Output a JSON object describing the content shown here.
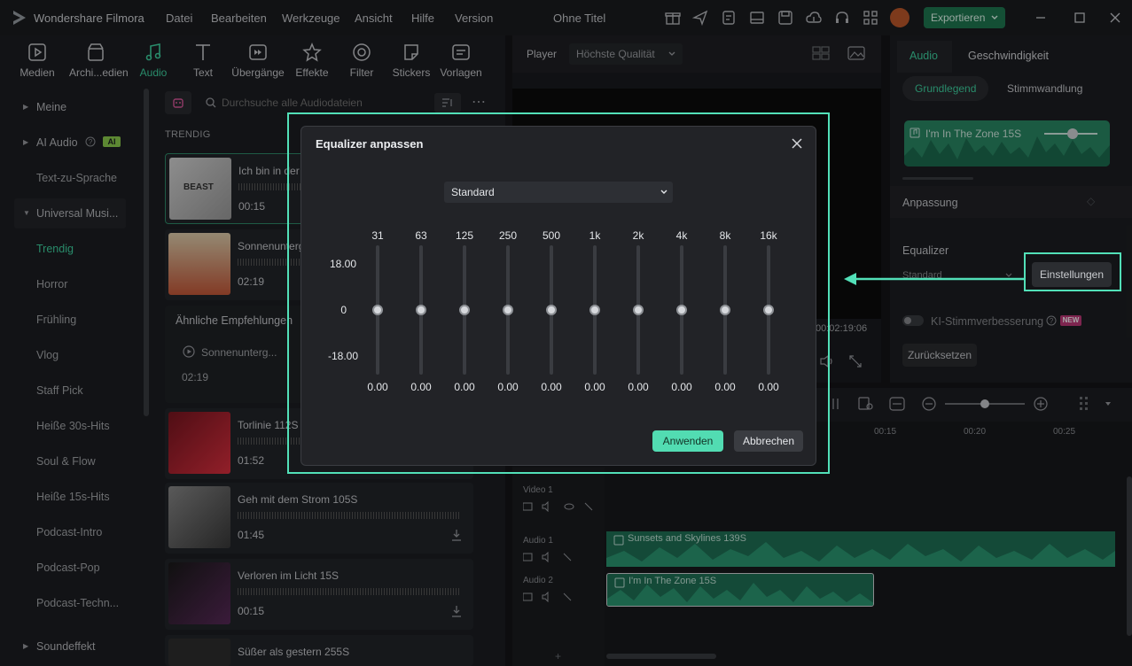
{
  "titlebar": {
    "app_name": "Wondershare Filmora",
    "menus": [
      "Datei",
      "Bearbeiten",
      "Werkzeuge",
      "Ansicht",
      "Hilfe",
      "Version"
    ],
    "document_title": "Ohne Titel",
    "export_label": "Exportieren",
    "accent": "#1f7a52"
  },
  "toolbar": {
    "items": [
      {
        "label": "Medien",
        "icon": "media-icon"
      },
      {
        "label": "Archi...edien",
        "icon": "archive-icon"
      },
      {
        "label": "Audio",
        "icon": "music-note-icon",
        "active": true
      },
      {
        "label": "Text",
        "icon": "text-icon"
      },
      {
        "label": "Übergänge",
        "icon": "transition-icon"
      },
      {
        "label": "Effekte",
        "icon": "effects-icon"
      },
      {
        "label": "Filter",
        "icon": "filter-icon"
      },
      {
        "label": "Stickers",
        "icon": "sticker-icon"
      },
      {
        "label": "Vorlagen",
        "icon": "template-icon"
      }
    ]
  },
  "categories": [
    {
      "label": "Meine",
      "parent": true,
      "collapsed": true
    },
    {
      "label": "AI Audio",
      "parent": true,
      "collapsed": true,
      "badge": "AI"
    },
    {
      "label": "Text-zu-Sprache"
    },
    {
      "label": "Universal Musi...",
      "parent": true,
      "expanded": true
    },
    {
      "label": "Trendig",
      "active": true
    },
    {
      "label": "Horror"
    },
    {
      "label": "Frühling"
    },
    {
      "label": "Vlog"
    },
    {
      "label": "Staff Pick"
    },
    {
      "label": "Heiße 30s-Hits"
    },
    {
      "label": "Soul & Flow"
    },
    {
      "label": "Heiße 15s-Hits"
    },
    {
      "label": "Podcast-Intro"
    },
    {
      "label": "Podcast-Pop"
    },
    {
      "label": "Podcast-Techn..."
    },
    {
      "label": "Soundeffekt",
      "parent": true,
      "collapsed": true
    }
  ],
  "search": {
    "placeholder": "Durchsuche alle Audiodateien"
  },
  "section_title": "TRENDIG",
  "tracks": [
    {
      "title": "Ich bin in der",
      "duration": "00:15",
      "selected": true
    },
    {
      "title": "Sonnenunterg",
      "duration": "02:19"
    },
    {
      "title": "Torlinie 112S",
      "duration": "01:52"
    },
    {
      "title": "Geh mit dem Strom 105S",
      "duration": "01:45"
    },
    {
      "title": "Verloren im Licht 15S",
      "duration": "00:15"
    },
    {
      "title": "Süßer als gestern 255S",
      "duration": ""
    }
  ],
  "recommendation": {
    "title": "Ähnliche Empfehlungen",
    "item": "Sonnenunterg...",
    "duration": "02:19"
  },
  "player": {
    "label": "Player",
    "quality": "Höchste Qualität",
    "timecode": "00:02:19:06"
  },
  "right_panel": {
    "tabs": [
      "Audio",
      "Geschwindigkeit"
    ],
    "subtabs": [
      "Grundlegend",
      "Stimmwandlung"
    ],
    "clip_name": "I'm In The Zone 15S",
    "anpassung": "Anpassung",
    "equalizer_label": "Equalizer",
    "equalizer_value": "Standard",
    "settings_button": "Einstellungen",
    "ai_voice": "KI-Stimmverbesserung",
    "new_badge": "NEW",
    "reset_button": "Zurücksetzen"
  },
  "timeline": {
    "ruler": [
      "00:15",
      "00:20",
      "00:25"
    ],
    "tracks": [
      {
        "name": "Video 1"
      },
      {
        "name": "Audio 1",
        "clip": "Sunsets and Skylines 139S"
      },
      {
        "name": "Audio 2",
        "clip": "I'm In The Zone 15S"
      }
    ]
  },
  "dialog": {
    "title": "Equalizer anpassen",
    "preset": "Standard",
    "db_labels": [
      "18.00",
      "0",
      "-18.00"
    ],
    "bands": [
      {
        "freq": "31",
        "value": "0.00"
      },
      {
        "freq": "63",
        "value": "0.00"
      },
      {
        "freq": "125",
        "value": "0.00"
      },
      {
        "freq": "250",
        "value": "0.00"
      },
      {
        "freq": "500",
        "value": "0.00"
      },
      {
        "freq": "1k",
        "value": "0.00"
      },
      {
        "freq": "2k",
        "value": "0.00"
      },
      {
        "freq": "4k",
        "value": "0.00"
      },
      {
        "freq": "8k",
        "value": "0.00"
      },
      {
        "freq": "16k",
        "value": "0.00"
      }
    ],
    "apply_label": "Anwenden",
    "cancel_label": "Abbrechen",
    "highlight_color": "#52e0b8"
  }
}
